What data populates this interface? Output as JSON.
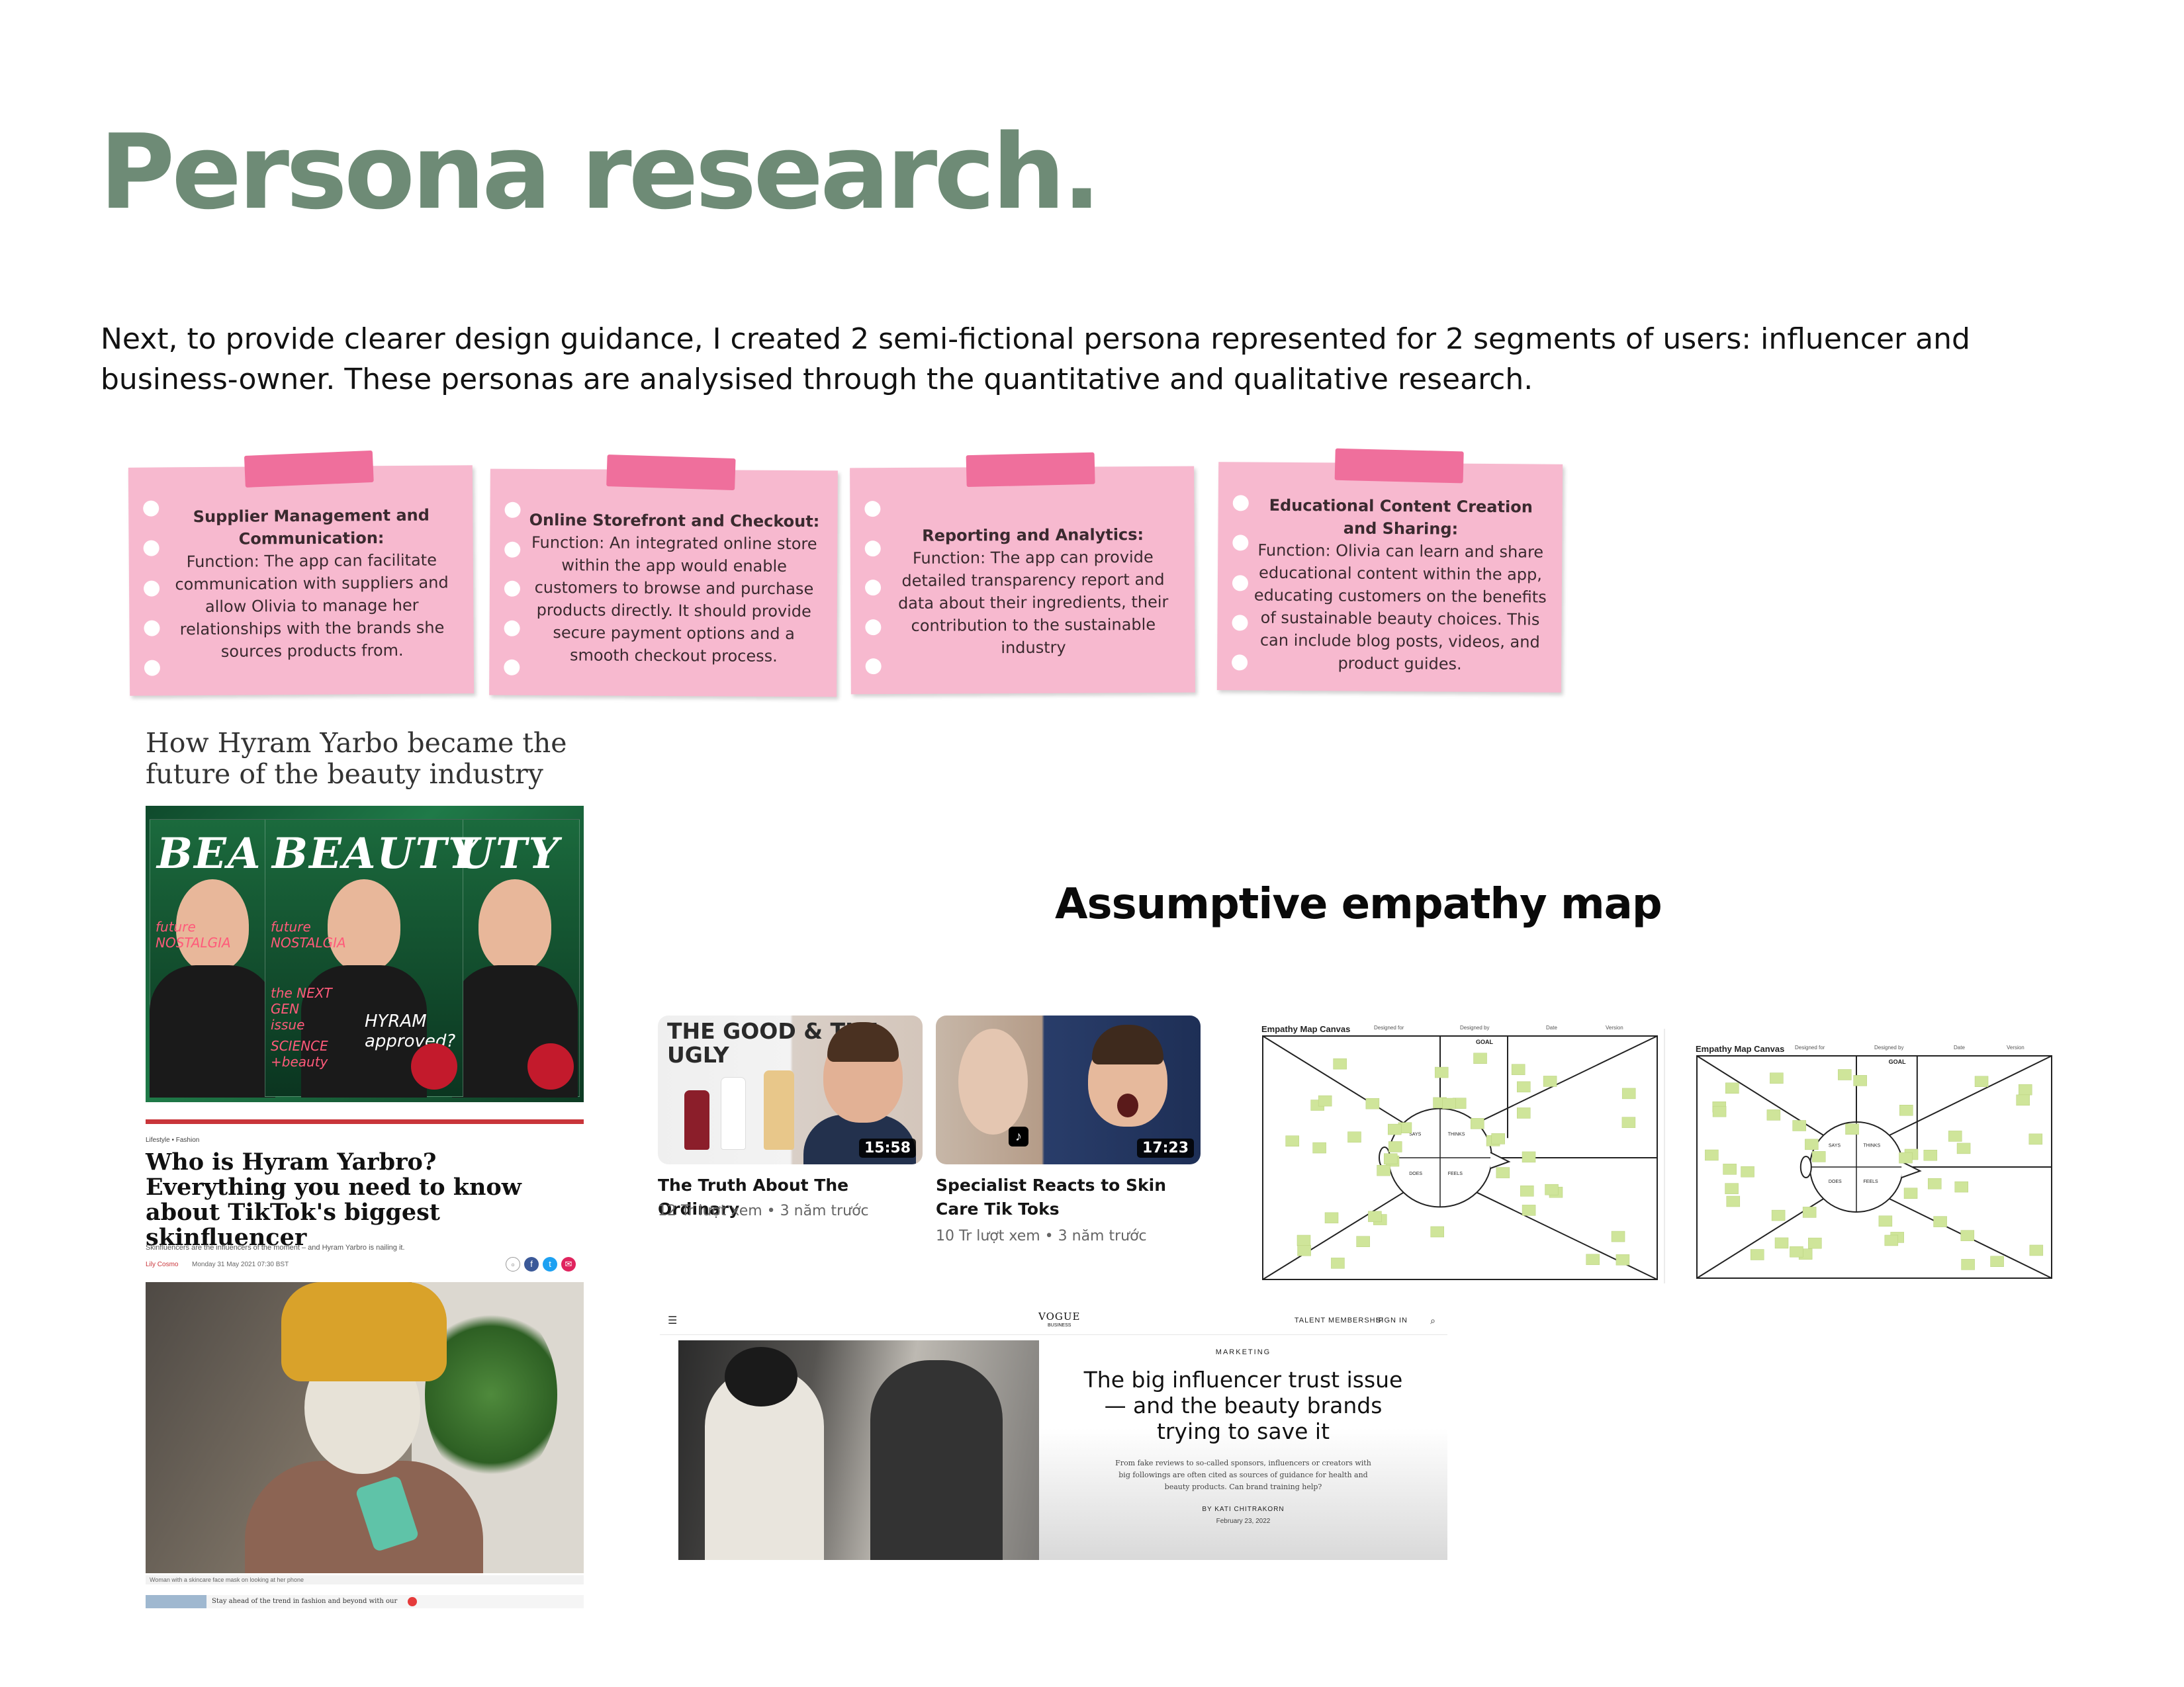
{
  "heading": "Persona research.",
  "intro": "Next, to provide clearer design guidance, I created 2 semi-fictional persona represented for 2 segments of users: influencer and business-owner. These personas are analysised through the quantitative and qualitative research.",
  "notes": [
    {
      "title": "Supplier Management and Communication:",
      "body": "Function: The app can facilitate communication with suppliers and allow Olivia to manage her relationships with the brands she sources products from."
    },
    {
      "title": "Online Storefront and Checkout:",
      "body": "Function: An integrated online store within the app would enable customers to browse and purchase products directly. It should provide secure payment options and a smooth checkout process."
    },
    {
      "title": "Reporting and Analytics:",
      "body": "Function: The app can provide detailed transparency report and data about their ingredients, their contribution to the sustainable industry"
    },
    {
      "title": "Educational Content Creation and Sharing:",
      "body": "Function: Olivia can learn and share educational content within the app, educating customers on the benefits of sustainable beauty choices. This can include blog posts, videos, and product guides."
    }
  ],
  "article1": {
    "headline": "How Hyram Yarbo became the future of the beauty industry",
    "cover": {
      "masthead_left": "BEA",
      "masthead_center": "BEAUTY",
      "masthead_right": "UTY",
      "tag1": "future NOSTALGIA",
      "tag2": "the NEXT GEN issue",
      "tag3": "HYRAM approved?",
      "tag4": "SCIENCE +beauty"
    }
  },
  "article2": {
    "breadcrumb": "Lifestyle • Fashion",
    "headline": "Who is Hyram Yarbro? Everything you need to know about TikTok's biggest skinfluencer",
    "standfirst": "Skinfluencers are the influencers of the moment – and Hyram Yarbro is nailing it.",
    "author": "Lily Cosmo",
    "date": "Monday 31 May 2021 07:30 BST",
    "caption": "Woman with a skincare face mask on looking at her phone",
    "teaser": "Stay ahead of the trend in fashion and beyond with our"
  },
  "empathy_title": "Assumptive empathy map",
  "videos": [
    {
      "thumb_text": "THE GOOD & THE UGLY",
      "duration": "15:58",
      "title": "The Truth About The Ordinary",
      "meta": "12 Tr lượt xem • 3 năm trước"
    },
    {
      "thumb_text": "",
      "duration": "17:23",
      "title": "Specialist Reacts to Skin Care Tik Toks",
      "meta": "10 Tr lượt xem • 3 năm trước"
    }
  ],
  "canvases": [
    {
      "title": "Empathy Map Canvas",
      "designed_for": "Designed for",
      "designed_by": "Designed by",
      "date": "Date",
      "version": "Version",
      "goal": "GOAL",
      "quadrants": [
        "SAYS",
        "THINKS",
        "DOES",
        "FEELS"
      ]
    },
    {
      "title": "Empathy Map Canvas",
      "designed_for": "Designed for",
      "designed_by": "Designed by",
      "date": "Date",
      "version": "Version",
      "goal": "GOAL",
      "quadrants": [
        "SAYS",
        "THINKS",
        "DOES",
        "FEELS"
      ]
    }
  ],
  "vogue": {
    "menu_icon": "hamburger-icon",
    "logo": "VOGUE",
    "logo_sub": "BUSINESS",
    "links": "TALENT  MEMBERSHIP",
    "sign_in": "SIGN IN",
    "category": "MARKETING",
    "headline": "The big influencer trust issue — and the beauty brands trying to save it",
    "dek": "From fake reviews to so-called sponsors, influencers or creators with big followings are often cited as sources of guidance for health and beauty products. Can brand training help?",
    "byline": "BY KATI CHITRAKORN",
    "date": "February 23, 2022"
  },
  "colors": {
    "heading": "#6e8b76",
    "note": "#f7b9cf",
    "tape": "#ef6f9c",
    "sticky": "#cfe59a"
  }
}
